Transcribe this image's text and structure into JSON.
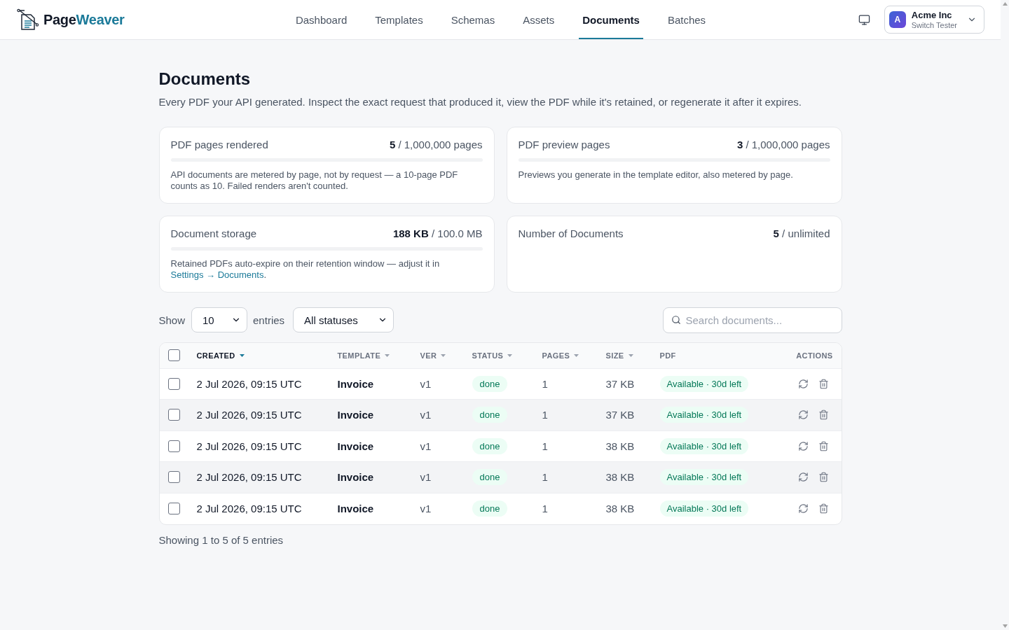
{
  "header": {
    "logo": {
      "lead": "Page",
      "accent": "Weaver"
    },
    "nav": [
      {
        "label": "Dashboard",
        "selected": false
      },
      {
        "label": "Templates",
        "selected": false
      },
      {
        "label": "Schemas",
        "selected": false
      },
      {
        "label": "Assets",
        "selected": false
      },
      {
        "label": "Documents",
        "selected": true
      },
      {
        "label": "Batches",
        "selected": false
      }
    ],
    "account": {
      "avatar": "A",
      "name": "Acme Inc",
      "subtitle": "Switch Tester"
    }
  },
  "page": {
    "title": "Documents",
    "description": "Every PDF your API generated. Inspect the exact request that produced it, view the PDF while it's retained, or regenerate it after it expires."
  },
  "usage_cards": [
    {
      "kind": "meter",
      "title": "PDF pages rendered",
      "value": "**5** / 1,000,000 pages",
      "note": "API documents are metered by page, not by request — a 10-page PDF counts as 10. Failed renders aren't counted."
    },
    {
      "kind": "meter",
      "title": "PDF preview pages",
      "value": "**3** / 1,000,000 pages",
      "note": "Previews you generate in the template editor, also metered by page."
    },
    {
      "kind": "meter",
      "title": "Document storage",
      "value": "**188 KB** / 100.0 MB",
      "note": "Retained PDFs auto-expire on their retention window — adjust it in",
      "link": "Settings → Documents",
      "note_end": "."
    },
    {
      "kind": "count",
      "title": "Number of Documents",
      "value": "**5** / unlimited"
    }
  ],
  "controls": {
    "show_label": "Show",
    "page_size": "10",
    "entries_label": "entries",
    "status_filter": "All statuses",
    "search": {
      "placeholder": "Search documents..."
    }
  },
  "table": {
    "select_all": {
      "checked": false
    },
    "columns": [
      {
        "label": "CREATED",
        "sortable": true,
        "sorted": true
      },
      {
        "label": "TEMPLATE",
        "sortable": true,
        "sorted": false
      },
      {
        "label": "VER",
        "sortable": true,
        "sorted": false
      },
      {
        "label": "STATUS",
        "sortable": true,
        "sorted": false
      },
      {
        "label": "PAGES",
        "sortable": true,
        "sorted": false
      },
      {
        "label": "SIZE",
        "sortable": true,
        "sorted": false
      },
      {
        "label": "PDF",
        "sortable": false,
        "sorted": false
      },
      {
        "label": "ACTIONS",
        "sortable": false,
        "sorted": false
      }
    ],
    "rows": [
      {
        "checked": false,
        "created": "2 Jul 2026, 09:15 UTC",
        "template": "Invoice",
        "version": "v1",
        "status": "done",
        "pages": "1",
        "size": "37 KB",
        "pdf": "Available · 30d left"
      },
      {
        "checked": false,
        "created": "2 Jul 2026, 09:15 UTC",
        "template": "Invoice",
        "version": "v1",
        "status": "done",
        "pages": "1",
        "size": "37 KB",
        "pdf": "Available · 30d left"
      },
      {
        "checked": false,
        "created": "2 Jul 2026, 09:15 UTC",
        "template": "Invoice",
        "version": "v1",
        "status": "done",
        "pages": "1",
        "size": "38 KB",
        "pdf": "Available · 30d left"
      },
      {
        "checked": false,
        "created": "2 Jul 2026, 09:15 UTC",
        "template": "Invoice",
        "version": "v1",
        "status": "done",
        "pages": "1",
        "size": "38 KB",
        "pdf": "Available · 30d left"
      },
      {
        "checked": false,
        "created": "2 Jul 2026, 09:15 UTC",
        "template": "Invoice",
        "version": "v1",
        "status": "done",
        "pages": "1",
        "size": "38 KB",
        "pdf": "Available · 30d left"
      }
    ]
  },
  "footer": {
    "summary": "Showing 1 to 5 of 5 entries"
  }
}
